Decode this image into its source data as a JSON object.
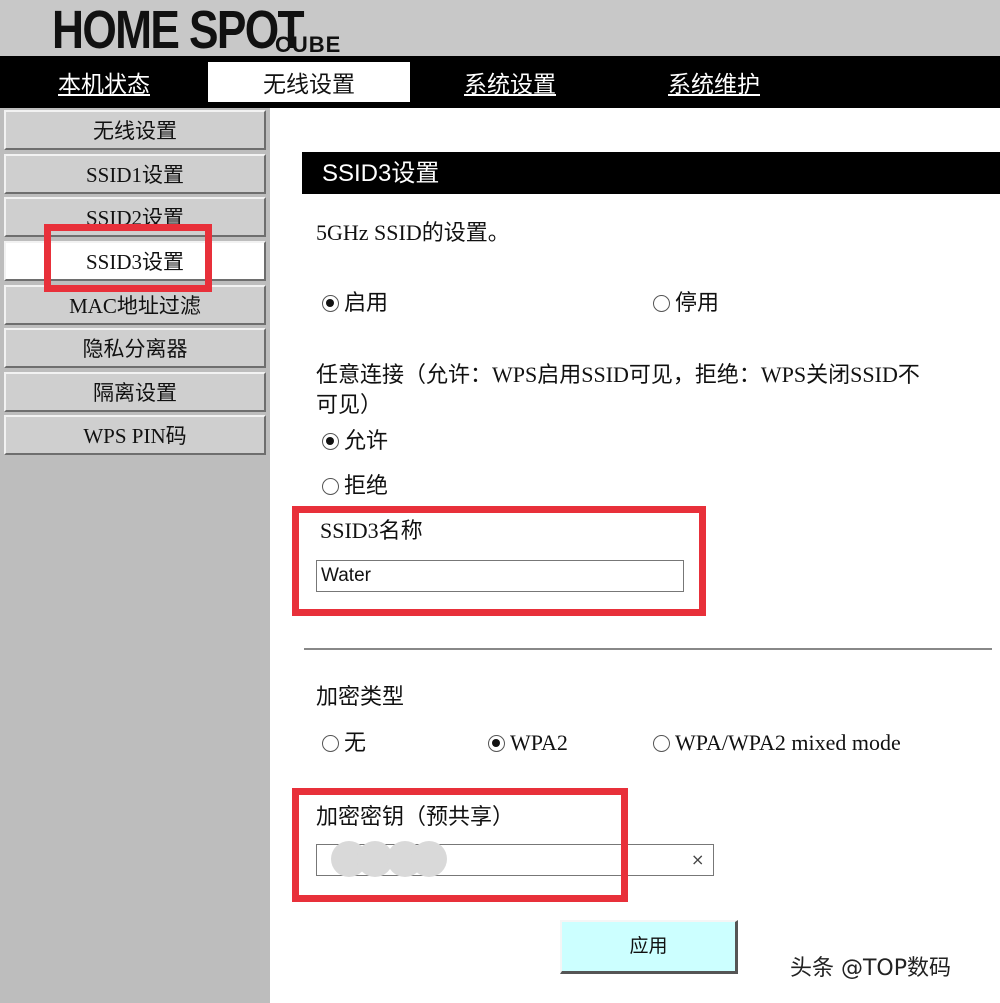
{
  "header": {
    "logo": "HOME SPOT",
    "logo_sub": "CUBE"
  },
  "nav": [
    {
      "label": "本机状态",
      "active": false
    },
    {
      "label": "无线设置",
      "active": true
    },
    {
      "label": "系统设置",
      "active": false
    },
    {
      "label": "系统维护",
      "active": false
    }
  ],
  "sidebar": {
    "items": [
      {
        "label": "无线设置"
      },
      {
        "label": "SSID1设置"
      },
      {
        "label": "SSID2设置"
      },
      {
        "label": "SSID3设置",
        "active": true
      },
      {
        "label": "MAC地址过滤"
      },
      {
        "label": "隐私分离器"
      },
      {
        "label": "隔离设置"
      },
      {
        "label": "WPS PIN码"
      }
    ]
  },
  "main": {
    "title": "SSID3设置",
    "description": "5GHz SSID的设置。",
    "status": {
      "enable_label": "启用",
      "disable_label": "停用",
      "selected": "enable"
    },
    "any_connection": {
      "description_line1": "任意连接（允许：WPS启用SSID可见，拒绝：WPS关闭SSID不",
      "description_line2": "可见）",
      "allow_label": "允许",
      "deny_label": "拒绝",
      "selected": "allow"
    },
    "ssid_name": {
      "label": "SSID3名称",
      "value": "Water"
    },
    "encryption": {
      "label": "加密类型",
      "none_label": "无",
      "wpa2_label": "WPA2",
      "mixed_label": "WPA/WPA2 mixed mode",
      "selected": "wpa2"
    },
    "key": {
      "label": "加密密钥（预共享）",
      "clear_symbol": "×"
    },
    "apply_label": "应用"
  },
  "watermark": "头条 @TOP数码",
  "colors": {
    "highlight": "#e8303a",
    "apply_button": "#ccffff",
    "nav_bg": "#000000",
    "sidebar_bg": "#bdbdbd"
  }
}
